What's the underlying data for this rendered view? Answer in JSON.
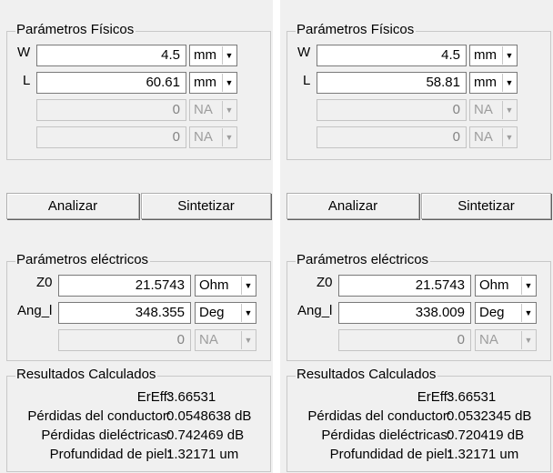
{
  "units_options": {
    "mm": "mm",
    "na": "NA",
    "ohm": "Ohm",
    "deg": "Deg"
  },
  "panels": [
    {
      "fisicos": {
        "title": "Parámetros Físicos",
        "w_label": "W",
        "w_value": "4.5",
        "l_label": "L",
        "l_value": "60.61",
        "p3_value": "0",
        "p4_value": "0"
      },
      "buttons": {
        "analizar": "Analizar",
        "sintetizar": "Sintetizar"
      },
      "electricos": {
        "title": "Parámetros eléctricos",
        "z0_label": "Z0",
        "z0_value": "21.5743",
        "ang_label": "Ang_l",
        "ang_value": "348.355",
        "e3_value": "0"
      },
      "resultados": {
        "title": "Resultados Calculados",
        "ereff_label": "ErEff:",
        "ereff_value": "3.66531",
        "perd_cond_label": "Pérdidas del conductor:",
        "perd_cond_value": "0.0548638 dB",
        "perd_diel_label": "Pérdidas dieléctricas:",
        "perd_diel_value": "0.742469 dB",
        "piel_label": "Profundidad de piel:",
        "piel_value": "1.32171 um"
      }
    },
    {
      "fisicos": {
        "title": "Parámetros Físicos",
        "w_label": "W",
        "w_value": "4.5",
        "l_label": "L",
        "l_value": "58.81",
        "p3_value": "0",
        "p4_value": "0"
      },
      "buttons": {
        "analizar": "Analizar",
        "sintetizar": "Sintetizar"
      },
      "electricos": {
        "title": "Parámetros eléctricos",
        "z0_label": "Z0",
        "z0_value": "21.5743",
        "ang_label": "Ang_l",
        "ang_value": "338.009",
        "e3_value": "0"
      },
      "resultados": {
        "title": "Resultados Calculados",
        "ereff_label": "ErEff:",
        "ereff_value": "3.66531",
        "perd_cond_label": "Pérdidas del conductor:",
        "perd_cond_value": "0.0532345 dB",
        "perd_diel_label": "Pérdidas dieléctricas:",
        "perd_diel_value": "0.720419 dB",
        "piel_label": "Profundidad de piel:",
        "piel_value": "1.32171 um"
      }
    }
  ]
}
